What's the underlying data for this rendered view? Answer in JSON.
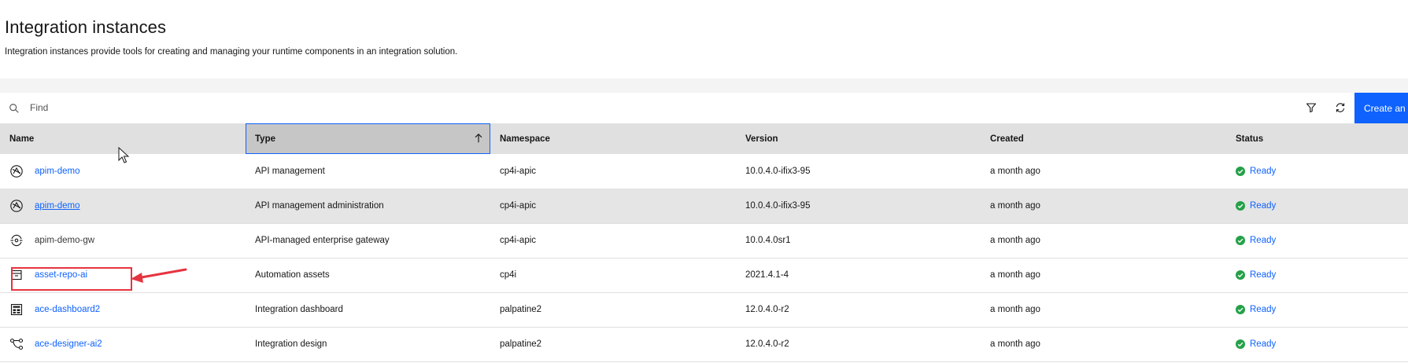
{
  "page": {
    "title": "Integration instances",
    "description": "Integration instances provide tools for creating and managing your runtime components in an integration solution."
  },
  "toolbar": {
    "search_placeholder": "Find",
    "search_icon": "search-icon",
    "filter_icon": "filter-icon",
    "refresh_icon": "refresh-icon",
    "create_label": "Create an i"
  },
  "table": {
    "headers": {
      "name": "Name",
      "type": "Type",
      "namespace": "Namespace",
      "version": "Version",
      "created": "Created",
      "status": "Status"
    },
    "sorted_column": "type",
    "sort_direction": "ascending",
    "rows": [
      {
        "icon": "api-management-icon",
        "name": "apim-demo",
        "name_style": "link",
        "type": "API management",
        "namespace": "cp4i-apic",
        "version": "10.0.4.0-ifix3-95",
        "created": "a month ago",
        "status": "Ready"
      },
      {
        "icon": "api-management-icon",
        "name": "apim-demo",
        "name_style": "link-underlined",
        "type": "API management administration",
        "namespace": "cp4i-apic",
        "version": "10.0.4.0-ifix3-95",
        "created": "a month ago",
        "status": "Ready"
      },
      {
        "icon": "gateway-icon",
        "name": "apim-demo-gw",
        "name_style": "plain",
        "type": "API-managed enterprise gateway",
        "namespace": "cp4i-apic",
        "version": "10.0.4.0sr1",
        "created": "a month ago",
        "status": "Ready"
      },
      {
        "icon": "automation-assets-icon",
        "name": "asset-repo-ai",
        "name_style": "link",
        "type": "Automation assets",
        "namespace": "cp4i",
        "version": "2021.4.1-4",
        "created": "a month ago",
        "status": "Ready"
      },
      {
        "icon": "dashboard-icon",
        "name": "ace-dashboard2",
        "name_style": "link",
        "type": "Integration dashboard",
        "namespace": "palpatine2",
        "version": "12.0.4.0-r2",
        "created": "a month ago",
        "status": "Ready"
      },
      {
        "icon": "design-flow-icon",
        "name": "ace-designer-ai2",
        "name_style": "link",
        "type": "Integration design",
        "namespace": "palpatine2",
        "version": "12.0.4.0-r2",
        "created": "a month ago",
        "status": "Ready"
      }
    ]
  },
  "colors": {
    "accent": "#0f62fe",
    "status_ok": "#24a148",
    "header_bg": "#e0e0e0",
    "annotation": "#e5343f"
  }
}
